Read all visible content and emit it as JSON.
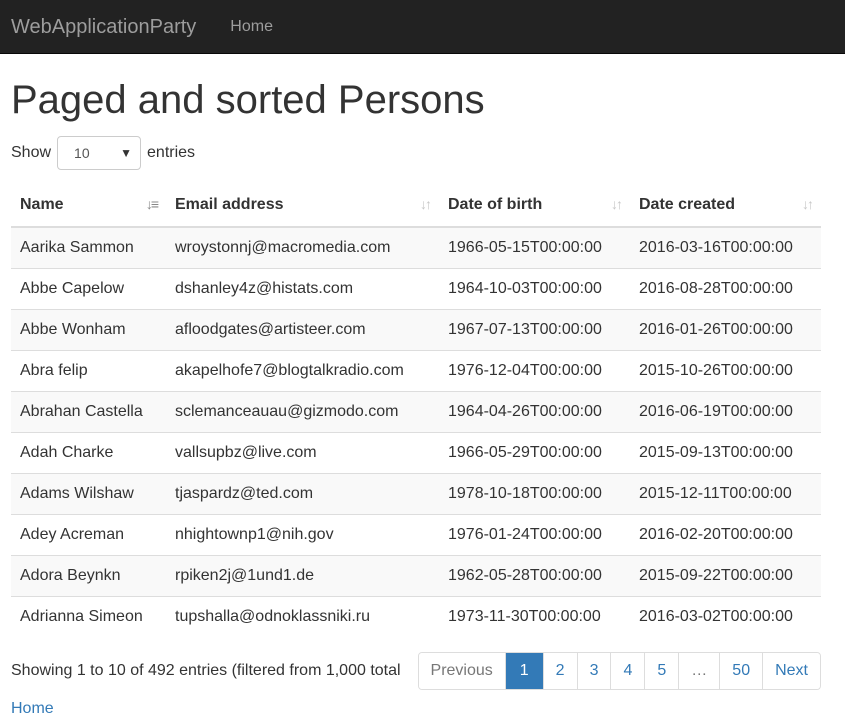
{
  "navbar": {
    "brand": "WebApplicationParty",
    "links": [
      {
        "label": "Home"
      }
    ]
  },
  "page_title": "Paged and sorted Persons",
  "length_menu": {
    "prefix": "Show",
    "selected": "10",
    "suffix": "entries"
  },
  "table": {
    "columns": [
      {
        "label": "Name",
        "sort": "ascending"
      },
      {
        "label": "Email address",
        "sort": "none"
      },
      {
        "label": "Date of birth",
        "sort": "none"
      },
      {
        "label": "Date created",
        "sort": "none"
      }
    ],
    "rows": [
      [
        "Aarika Sammon",
        "wroystonnj@macromedia.com",
        "1966-05-15T00:00:00",
        "2016-03-16T00:00:00"
      ],
      [
        "Abbe Capelow",
        "dshanley4z@histats.com",
        "1964-10-03T00:00:00",
        "2016-08-28T00:00:00"
      ],
      [
        "Abbe Wonham",
        "afloodgates@artisteer.com",
        "1967-07-13T00:00:00",
        "2016-01-26T00:00:00"
      ],
      [
        "Abra felip",
        "akapelhofe7@blogtalkradio.com",
        "1976-12-04T00:00:00",
        "2015-10-26T00:00:00"
      ],
      [
        "Abrahan Castella",
        "sclemanceauau@gizmodo.com",
        "1964-04-26T00:00:00",
        "2016-06-19T00:00:00"
      ],
      [
        "Adah Charke",
        "vallsupbz@live.com",
        "1966-05-29T00:00:00",
        "2015-09-13T00:00:00"
      ],
      [
        "Adams Wilshaw",
        "tjaspardz@ted.com",
        "1978-10-18T00:00:00",
        "2015-12-11T00:00:00"
      ],
      [
        "Adey Acreman",
        "nhightownp1@nih.gov",
        "1976-01-24T00:00:00",
        "2016-02-20T00:00:00"
      ],
      [
        "Adora Beynkn",
        "rpiken2j@1und1.de",
        "1962-05-28T00:00:00",
        "2015-09-22T00:00:00"
      ],
      [
        "Adrianna Simeon",
        "tupshalla@odnoklassniki.ru",
        "1973-11-30T00:00:00",
        "2016-03-02T00:00:00"
      ]
    ]
  },
  "info_text": "Showing 1 to 10 of 492 entries (filtered from 1,000 total",
  "pagination": {
    "previous": "Previous",
    "pages": [
      "1",
      "2",
      "3",
      "4",
      "5",
      "…",
      "50"
    ],
    "active_page": "1",
    "next": "Next"
  },
  "footer": {
    "home_link": "Home"
  },
  "colors": {
    "navbar_bg": "#222222",
    "navbar_text": "#9d9d9d",
    "link": "#337ab7",
    "active_page_bg": "#337ab7",
    "stripe": "#f9f9f9"
  },
  "icons": {
    "sort_ascending": "sort-alpha-asc-icon",
    "sort_none": "sort-both-icon",
    "dropdown": "caret-down-icon"
  }
}
